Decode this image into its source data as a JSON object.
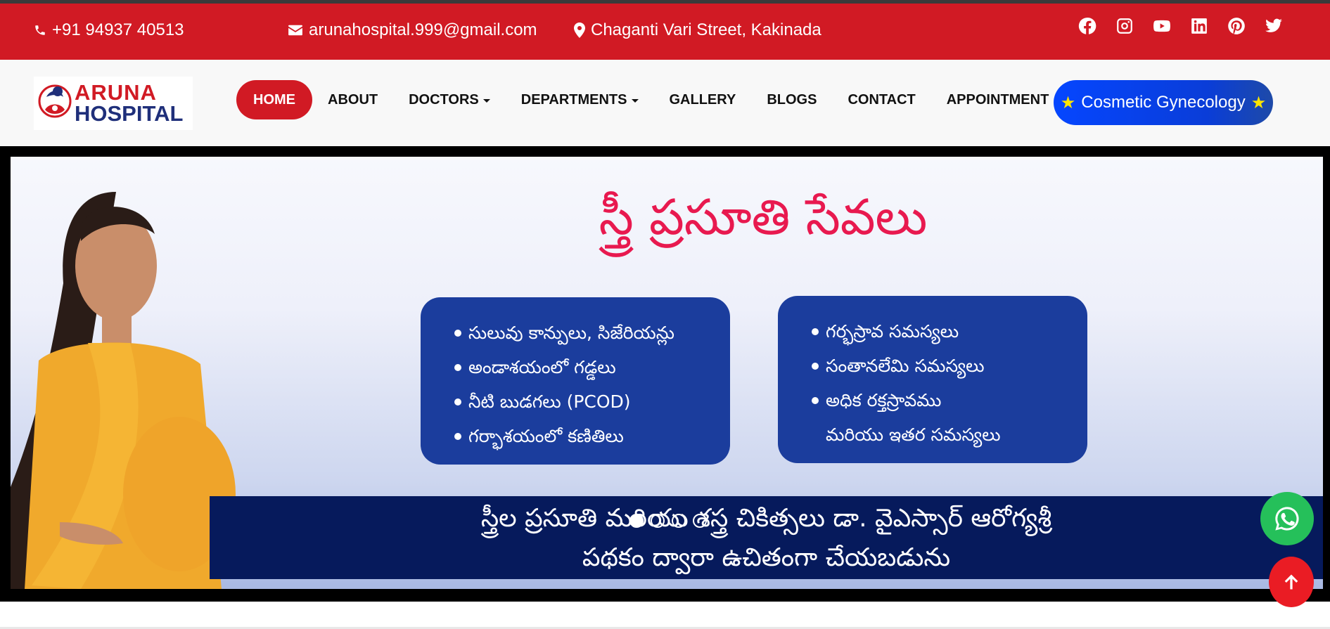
{
  "topbar": {
    "phone": "+91 94937 40513",
    "email": "arunahospital.999@gmail.com",
    "address": "Chaganti Vari Street, Kakinada",
    "socials": [
      "facebook-icon",
      "instagram-icon",
      "youtube-icon",
      "linkedin-icon",
      "pinterest-icon",
      "twitter-icon"
    ],
    "color": "#d11a24"
  },
  "logo": {
    "line1": "ARUNA",
    "line2": "HOSPITAL"
  },
  "nav": {
    "items": [
      {
        "label": "HOME",
        "active": true,
        "dropdown": false
      },
      {
        "label": "ABOUT",
        "active": false,
        "dropdown": false
      },
      {
        "label": "DOCTORS",
        "active": false,
        "dropdown": true
      },
      {
        "label": "DEPARTMENTS",
        "active": false,
        "dropdown": true
      },
      {
        "label": "GALLERY",
        "active": false,
        "dropdown": false
      },
      {
        "label": "BLOGS",
        "active": false,
        "dropdown": false
      },
      {
        "label": "CONTACT",
        "active": false,
        "dropdown": false
      },
      {
        "label": "APPOINTMENT",
        "active": false,
        "dropdown": false
      }
    ],
    "cta": "Cosmetic Gynecology"
  },
  "hero": {
    "title": "స్త్రీ ప్రసూతి సేవలు",
    "left_card": [
      "సులువు కాన్పులు, సిజేరియన్లు",
      "అండాశయంలో గడ్డలు",
      "నీటి బుడగలు (PCOD)",
      "గర్భాశయంలో కణితిలు"
    ],
    "right_card": [
      "గర్భస్రావ సమస్యలు",
      "సంతానలేమి సమస్యలు",
      "అధిక రక్తస్రావము"
    ],
    "right_card_cont": "మరియు ఇతర సమస్యలు",
    "banner_line1": "స్త్రీల ప్రసూతి మరియు శస్త్ర చికిత్సలు డా. వైఎస్సార్ ఆరోగ్యశ్రీ",
    "banner_line2": "పథకం ద్వారా ఉచితంగా చేయబడును",
    "slides_count": 4,
    "active_slide": 1
  }
}
